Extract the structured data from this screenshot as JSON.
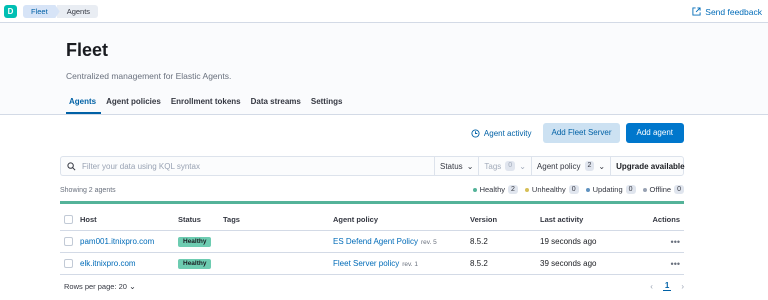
{
  "app": {
    "logo_letter": "D"
  },
  "breadcrumbs": [
    "Fleet",
    "Agents"
  ],
  "header_links": {
    "feedback": "Send feedback"
  },
  "page": {
    "title": "Fleet",
    "subtitle": "Centralized management for Elastic Agents."
  },
  "tabs": [
    {
      "label": "Agents",
      "active": true
    },
    {
      "label": "Agent policies"
    },
    {
      "label": "Enrollment tokens"
    },
    {
      "label": "Data streams"
    },
    {
      "label": "Settings"
    }
  ],
  "actions": {
    "activity": "Agent activity",
    "add_fleet_server": "Add Fleet Server",
    "add_agent": "Add agent"
  },
  "search": {
    "placeholder": "Filter your data using KQL syntax"
  },
  "filters": {
    "status": "Status",
    "tags": "Tags",
    "tags_count": "0",
    "agent_policy": "Agent policy",
    "agent_policy_count": "2",
    "upgrade": "Upgrade available"
  },
  "summary": {
    "showing": "Showing 2 agents",
    "healthy": "Healthy",
    "healthy_count": "2",
    "unhealthy": "Unhealthy",
    "unhealthy_count": "0",
    "updating": "Updating",
    "updating_count": "0",
    "offline": "Offline",
    "offline_count": "0"
  },
  "colors": {
    "healthy": "#54b399",
    "unhealthy": "#d6bf57",
    "updating": "#6092c0",
    "offline": "#98a2b3"
  },
  "table": {
    "columns": {
      "host": "Host",
      "status": "Status",
      "tags": "Tags",
      "policy": "Agent policy",
      "version": "Version",
      "activity": "Last activity",
      "actions": "Actions"
    },
    "rows": [
      {
        "host": "pam001.itnixpro.com",
        "status": "Healthy",
        "policy": "ES Defend Agent Policy",
        "rev": "rev. 5",
        "version": "8.5.2",
        "activity": "19 seconds ago"
      },
      {
        "host": "elk.itnixpro.com",
        "status": "Healthy",
        "policy": "Fleet Server policy",
        "rev": "rev. 1",
        "version": "8.5.2",
        "activity": "39 seconds ago"
      }
    ]
  },
  "footer": {
    "rows_per_page": "Rows per page: 20",
    "current_page": "1"
  }
}
